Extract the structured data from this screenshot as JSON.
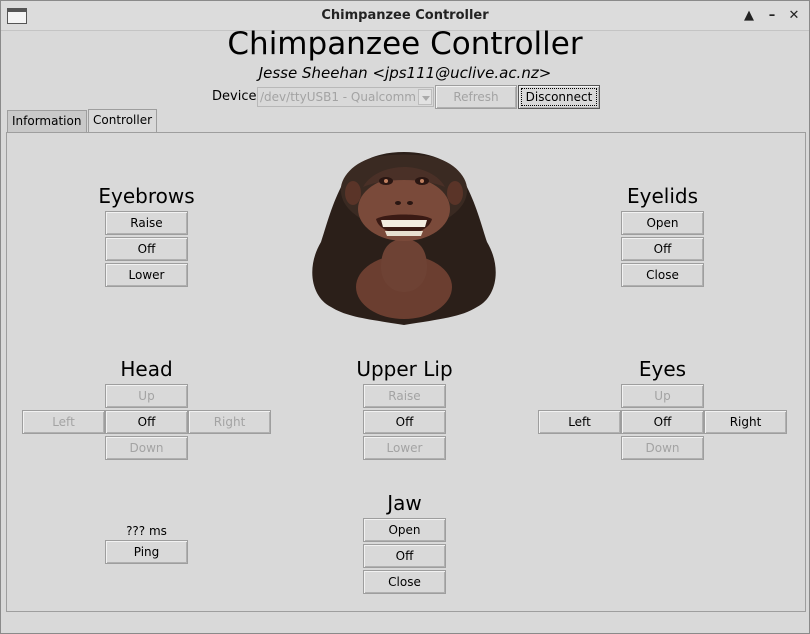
{
  "window": {
    "title": "Chimpanzee Controller",
    "controls": {
      "maximize": "▲",
      "minimize": "–",
      "close": "✕"
    }
  },
  "header": {
    "title": "Chimpanzee Controller",
    "subtitle": "Jesse Sheehan <jps111@uclive.ac.nz>"
  },
  "device": {
    "label": "Device:",
    "value": "/dev/ttyUSB1 - Qualcomm",
    "refresh_label": "Refresh",
    "disconnect_label": "Disconnect"
  },
  "tabs": [
    {
      "label": "Information",
      "active": false
    },
    {
      "label": "Controller",
      "active": true
    }
  ],
  "eyebrows": {
    "title": "Eyebrows",
    "raise": "Raise",
    "off": "Off",
    "lower": "Lower"
  },
  "eyelids": {
    "title": "Eyelids",
    "open": "Open",
    "off": "Off",
    "close": "Close"
  },
  "head": {
    "title": "Head",
    "up": "Up",
    "left": "Left",
    "off": "Off",
    "right": "Right",
    "down": "Down"
  },
  "upper_lip": {
    "title": "Upper Lip",
    "raise": "Raise",
    "off": "Off",
    "lower": "Lower"
  },
  "eyes": {
    "title": "Eyes",
    "up": "Up",
    "left": "Left",
    "off": "Off",
    "right": "Right",
    "down": "Down"
  },
  "jaw": {
    "title": "Jaw",
    "open": "Open",
    "off": "Off",
    "close": "Close"
  },
  "ping": {
    "latency": "??? ms",
    "button_label": "Ping"
  },
  "colors": {
    "background": "#d9d9d9",
    "disabled_text": "#a3a3a3",
    "fur": "#2b1f19",
    "skin": "#7a4a3a"
  }
}
